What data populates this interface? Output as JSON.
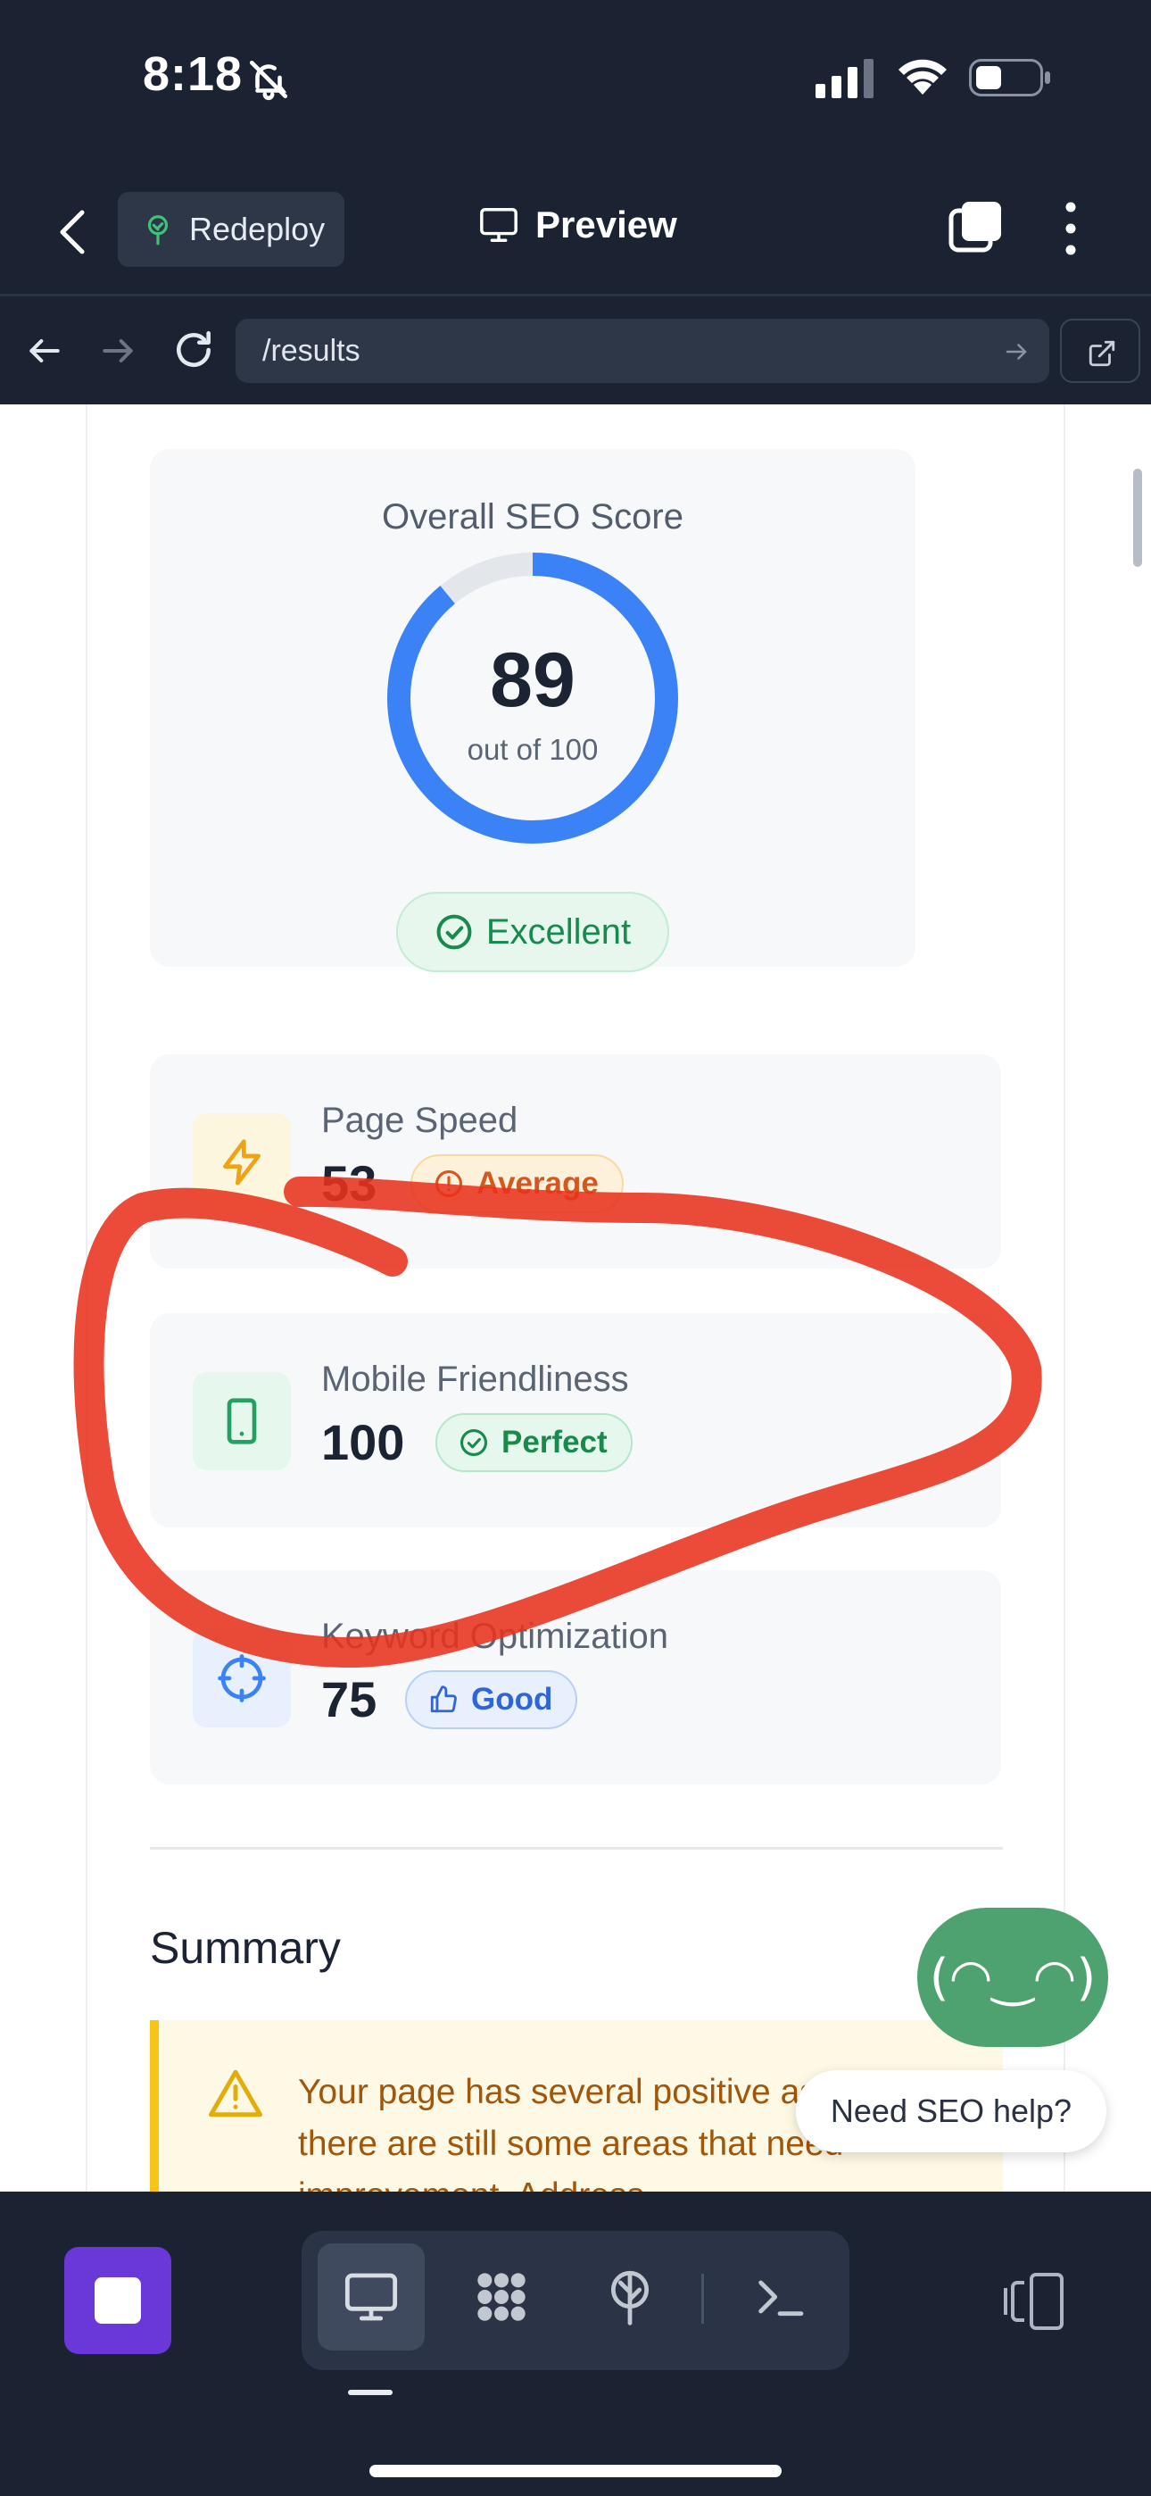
{
  "status_bar": {
    "time": "8:18"
  },
  "header": {
    "redeploy_label": "Redeploy",
    "title": "Preview"
  },
  "browser": {
    "url": "/results"
  },
  "seo": {
    "title": "Overall SEO Score",
    "score": "89",
    "score_subtitle": "out of 100",
    "score_fraction": 0.89,
    "rating": "Excellent"
  },
  "metrics": [
    {
      "label": "Page Speed",
      "value": "53",
      "badge": "Average"
    },
    {
      "label": "Mobile Friendliness",
      "value": "100",
      "badge": "Perfect"
    },
    {
      "label": "Keyword Optimization",
      "value": "75",
      "badge": "Good"
    }
  ],
  "summary": {
    "title": "Summary",
    "text": "Your page has several positive aspects but there are still some areas that need improvement. Address..."
  },
  "chat": {
    "face": "(◠‿◠)",
    "help_label": "Need SEO help?"
  },
  "colors": {
    "accent_blue": "#3b82f6",
    "success_green": "#18894f",
    "warning_orange": "#d5571f",
    "annotation_red": "#e8321c",
    "stop_purple": "#6a37d8"
  },
  "icons": [
    "bell-slash-icon",
    "signal-icon",
    "wifi-icon",
    "battery-icon",
    "chevron-left-icon",
    "tree-icon",
    "monitor-icon",
    "tabs-icon",
    "more-vertical-icon",
    "arrow-left-icon",
    "arrow-right-icon",
    "reload-icon",
    "external-link-icon",
    "check-circle-icon",
    "lightning-icon",
    "alert-circle-icon",
    "smartphone-icon",
    "target-icon",
    "thumbs-up-icon",
    "warning-triangle-icon",
    "stop-icon",
    "grid-icon",
    "terminal-icon",
    "devices-icon"
  ]
}
